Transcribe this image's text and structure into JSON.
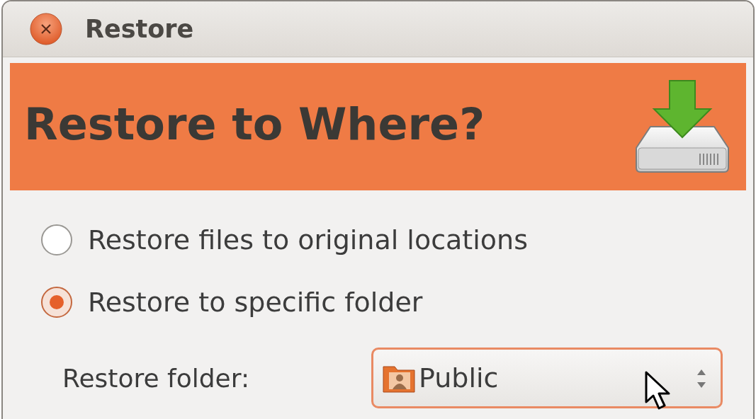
{
  "window": {
    "title": "Restore"
  },
  "banner": {
    "title": "Restore to Where?"
  },
  "options": [
    {
      "label": "Restore files to original locations",
      "selected": false
    },
    {
      "label": "Restore to specific folder",
      "selected": true
    }
  ],
  "folder": {
    "label": "Restore folder:",
    "value": "Public"
  }
}
